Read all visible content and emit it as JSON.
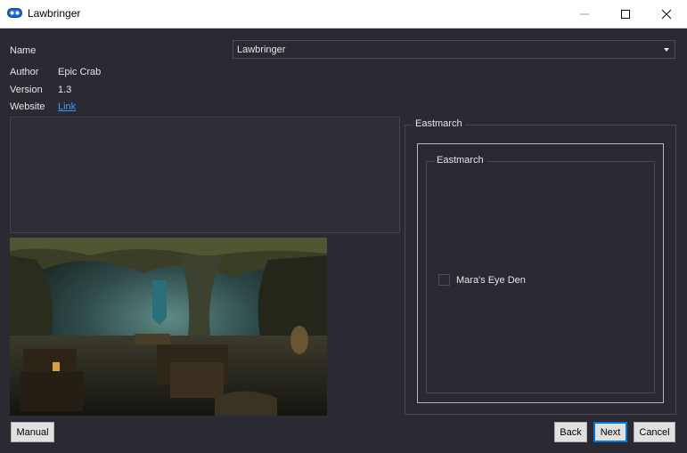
{
  "window": {
    "title": "Lawbringer",
    "minimize_icon": "minimize-icon",
    "maximize_icon": "maximize-icon",
    "close_icon": "close-icon"
  },
  "mod_info": {
    "name_label": "Name",
    "name_value": "Lawbringer",
    "author_label": "Author",
    "author_value": "Epic Crab",
    "version_label": "Version",
    "version_value": "1.3",
    "website_label": "Website",
    "website_link_text": "Link"
  },
  "options": {
    "group_title": "Eastmarch",
    "subgroup_title": "Eastmarch",
    "items": [
      {
        "label": "Mara's Eye Den",
        "checked": false
      }
    ]
  },
  "buttons": {
    "manual": "Manual",
    "back": "Back",
    "next": "Next",
    "cancel": "Cancel"
  },
  "colors": {
    "background": "#2b2a33",
    "link": "#3b9cff",
    "titlebar": "#ffffff",
    "focus_border": "#0078d7"
  }
}
